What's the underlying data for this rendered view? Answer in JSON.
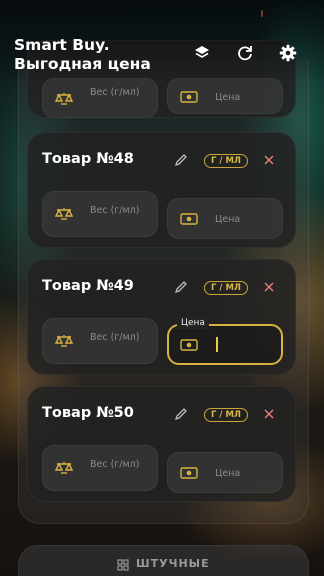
{
  "header": {
    "title": "Smart Buy. Выгодная цена",
    "buttons": [
      {
        "icon": "layers-icon"
      },
      {
        "icon": "refresh-icon"
      },
      {
        "icon": "gear-icon"
      }
    ]
  },
  "items": [
    {
      "title": "",
      "unit": "",
      "weight_placeholder": "Вес (г/мл)",
      "price_placeholder": "Цена",
      "partial": true
    },
    {
      "title": "Товар №48",
      "unit": "Г / МЛ",
      "weight_placeholder": "Вес (г/мл)",
      "price_placeholder": "Цена"
    },
    {
      "title": "Товар №49",
      "unit": "Г / МЛ",
      "weight_placeholder": "Вес (г/мл)",
      "price_label": "Цена",
      "price_value": "",
      "price_focused": true
    },
    {
      "title": "Товар №50",
      "unit": "Г / МЛ",
      "weight_placeholder": "Вес (г/мл)",
      "price_placeholder": "Цена"
    }
  ],
  "bottom_tab": {
    "label": "ШТУЧНЫЕ",
    "icon": "grid-icon"
  },
  "colors": {
    "accent": "#d7b23f",
    "close": "#e07d7d",
    "card": "#222222"
  }
}
